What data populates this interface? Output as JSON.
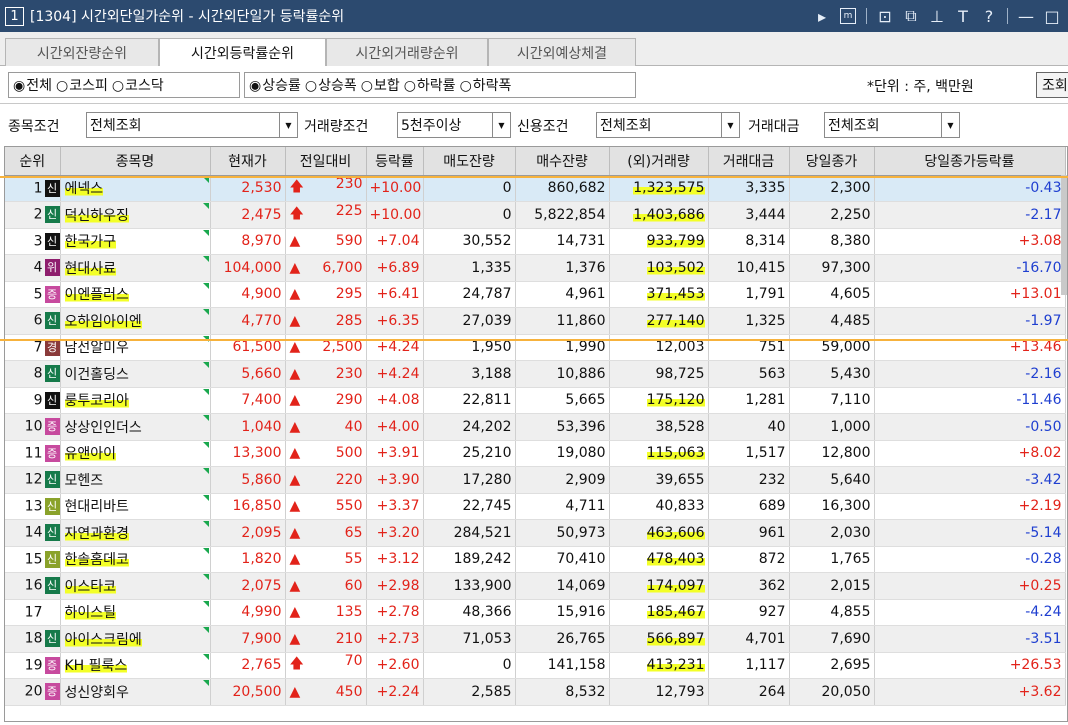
{
  "window": {
    "number": "1",
    "title": "[1304] 시간외단일가순위 - 시간외단일가 등락률순위"
  },
  "tabs": [
    {
      "label": "시간외잔량순위"
    },
    {
      "label": "시간외등락률순위"
    },
    {
      "label": "시간외거래량순위"
    },
    {
      "label": "시간외예상체결"
    }
  ],
  "market_options": [
    "전체",
    "코스피",
    "코스닥"
  ],
  "sort_options": [
    "상승률",
    "상승폭",
    "보합",
    "하락률",
    "하락폭"
  ],
  "unit_text": "*단위 : 주, 백만원",
  "lookup_label": "조회",
  "conditions": {
    "stock_label": "종목조건",
    "stock_value": "전체조회",
    "volume_label": "거래량조건",
    "volume_value": "5천주이상",
    "credit_label": "신용조건",
    "credit_value": "전체조회",
    "amount_label": "거래대금",
    "amount_value": "전체조회"
  },
  "columns": [
    "순위",
    "종목명",
    "현재가",
    "전일대비",
    "등락률",
    "매도잔량",
    "매수잔량",
    "(외)거래량",
    "거래대금",
    "당일종가",
    "당일종가등락률"
  ],
  "rows": [
    {
      "rank": "1",
      "badge": "신",
      "badge_color": "black",
      "name": "에넥스",
      "price": "2,530",
      "change": "230",
      "arrow": "upper",
      "rate": "+10.00",
      "sell": "0",
      "buy": "860,682",
      "volume": "1,323,575",
      "amount": "3,335",
      "close": "2,300",
      "close_rate": "-0.43"
    },
    {
      "rank": "2",
      "badge": "신",
      "badge_color": "green",
      "name": "덕신하우징",
      "price": "2,475",
      "change": "225",
      "arrow": "upper",
      "rate": "+10.00",
      "sell": "0",
      "buy": "5,822,854",
      "volume": "1,403,686",
      "amount": "3,444",
      "close": "2,250",
      "close_rate": "-2.17"
    },
    {
      "rank": "3",
      "badge": "신",
      "badge_color": "black",
      "name": "한국가구",
      "price": "8,970",
      "change": "590",
      "arrow": "up",
      "rate": "+7.04",
      "sell": "30,552",
      "buy": "14,731",
      "volume": "933,799",
      "amount": "8,314",
      "close": "8,380",
      "close_rate": "+3.08"
    },
    {
      "rank": "4",
      "badge": "위",
      "badge_color": "purple",
      "name": "현대사료",
      "price": "104,000",
      "change": "6,700",
      "arrow": "up",
      "rate": "+6.89",
      "sell": "1,335",
      "buy": "1,376",
      "volume": "103,502",
      "amount": "10,415",
      "close": "97,300",
      "close_rate": "-16.70"
    },
    {
      "rank": "5",
      "badge": "증",
      "badge_color": "pink",
      "name": "이엔플러스",
      "price": "4,900",
      "change": "295",
      "arrow": "up",
      "rate": "+6.41",
      "sell": "24,787",
      "buy": "4,961",
      "volume": "371,453",
      "amount": "1,791",
      "close": "4,605",
      "close_rate": "+13.01"
    },
    {
      "rank": "6",
      "badge": "신",
      "badge_color": "green",
      "name": "오하임아이엔",
      "price": "4,770",
      "change": "285",
      "arrow": "up",
      "rate": "+6.35",
      "sell": "27,039",
      "buy": "11,860",
      "volume": "277,140",
      "amount": "1,325",
      "close": "4,485",
      "close_rate": "-1.97"
    },
    {
      "rank": "7",
      "badge": "경",
      "badge_color": "maroon",
      "name": "남선알미우",
      "price": "61,500",
      "change": "2,500",
      "arrow": "up",
      "rate": "+4.24",
      "sell": "1,950",
      "buy": "1,990",
      "volume": "12,003",
      "amount": "751",
      "close": "59,000",
      "close_rate": "+13.46"
    },
    {
      "rank": "8",
      "badge": "신",
      "badge_color": "green",
      "name": "이건홀딩스",
      "price": "5,660",
      "change": "230",
      "arrow": "up",
      "rate": "+4.24",
      "sell": "3,188",
      "buy": "10,886",
      "volume": "98,725",
      "amount": "563",
      "close": "5,430",
      "close_rate": "-2.16"
    },
    {
      "rank": "9",
      "badge": "신",
      "badge_color": "black",
      "name": "룽투코리아",
      "price": "7,400",
      "change": "290",
      "arrow": "up",
      "rate": "+4.08",
      "sell": "22,811",
      "buy": "5,665",
      "volume": "175,120",
      "amount": "1,281",
      "close": "7,110",
      "close_rate": "-11.46"
    },
    {
      "rank": "10",
      "badge": "증",
      "badge_color": "pink",
      "name": "상상인인더스",
      "price": "1,040",
      "change": "40",
      "arrow": "up",
      "rate": "+4.00",
      "sell": "24,202",
      "buy": "53,396",
      "volume": "38,528",
      "amount": "40",
      "close": "1,000",
      "close_rate": "-0.50"
    },
    {
      "rank": "11",
      "badge": "증",
      "badge_color": "pink",
      "name": "유앤아이",
      "price": "13,300",
      "change": "500",
      "arrow": "up",
      "rate": "+3.91",
      "sell": "25,210",
      "buy": "19,080",
      "volume": "115,063",
      "amount": "1,517",
      "close": "12,800",
      "close_rate": "+8.02"
    },
    {
      "rank": "12",
      "badge": "신",
      "badge_color": "green",
      "name": "모헨즈",
      "price": "5,860",
      "change": "220",
      "arrow": "up",
      "rate": "+3.90",
      "sell": "17,280",
      "buy": "2,909",
      "volume": "39,655",
      "amount": "232",
      "close": "5,640",
      "close_rate": "-3.42"
    },
    {
      "rank": "13",
      "badge": "신",
      "badge_color": "olive",
      "name": "현대리바트",
      "price": "16,850",
      "change": "550",
      "arrow": "up",
      "rate": "+3.37",
      "sell": "22,745",
      "buy": "4,711",
      "volume": "40,833",
      "amount": "689",
      "close": "16,300",
      "close_rate": "+2.19"
    },
    {
      "rank": "14",
      "badge": "신",
      "badge_color": "green",
      "name": "자연과환경",
      "price": "2,095",
      "change": "65",
      "arrow": "up",
      "rate": "+3.20",
      "sell": "284,521",
      "buy": "50,973",
      "volume": "463,606",
      "amount": "961",
      "close": "2,030",
      "close_rate": "-5.14"
    },
    {
      "rank": "15",
      "badge": "신",
      "badge_color": "olive",
      "name": "한솔홈데코",
      "price": "1,820",
      "change": "55",
      "arrow": "up",
      "rate": "+3.12",
      "sell": "189,242",
      "buy": "70,410",
      "volume": "478,403",
      "amount": "872",
      "close": "1,765",
      "close_rate": "-0.28"
    },
    {
      "rank": "16",
      "badge": "신",
      "badge_color": "green",
      "name": "이스타코",
      "price": "2,075",
      "change": "60",
      "arrow": "up",
      "rate": "+2.98",
      "sell": "133,900",
      "buy": "14,069",
      "volume": "174,097",
      "amount": "362",
      "close": "2,015",
      "close_rate": "+0.25"
    },
    {
      "rank": "17",
      "badge": "",
      "badge_color": "",
      "name": "하이스틸",
      "price": "4,990",
      "change": "135",
      "arrow": "up",
      "rate": "+2.78",
      "sell": "48,366",
      "buy": "15,916",
      "volume": "185,467",
      "amount": "927",
      "close": "4,855",
      "close_rate": "-4.24"
    },
    {
      "rank": "18",
      "badge": "신",
      "badge_color": "green",
      "name": "아이스크림에",
      "price": "7,900",
      "change": "210",
      "arrow": "up",
      "rate": "+2.73",
      "sell": "71,053",
      "buy": "26,765",
      "volume": "566,897",
      "amount": "4,701",
      "close": "7,690",
      "close_rate": "-3.51"
    },
    {
      "rank": "19",
      "badge": "증",
      "badge_color": "pink",
      "name": "KH 필룩스",
      "price": "2,765",
      "change": "70",
      "arrow": "upper",
      "rate": "+2.60",
      "sell": "0",
      "buy": "141,158",
      "volume": "413,231",
      "amount": "1,117",
      "close": "2,695",
      "close_rate": "+26.53"
    },
    {
      "rank": "20",
      "badge": "증",
      "badge_color": "pink",
      "name": "성신양회우",
      "price": "20,500",
      "change": "450",
      "arrow": "up",
      "rate": "+2.24",
      "sell": "2,585",
      "buy": "8,532",
      "volume": "12,793",
      "amount": "264",
      "close": "20,050",
      "close_rate": "+3.62"
    }
  ],
  "highlighted_names": [
    "에넥스",
    "덕신하우징",
    "한국가구",
    "현대사료",
    "이엔플러스",
    "오하임아이엔",
    "룽투코리아",
    "유앤아이",
    "자연과환경",
    "한솔홈데코",
    "이스타코",
    "하이스틸",
    "아이스크림에",
    "KH 필룩스"
  ],
  "highlighted_volumes": [
    "1,323,575",
    "1,403,686",
    "933,799",
    "103,502",
    "371,453",
    "277,140",
    "175,120",
    "115,063",
    "463,606",
    "478,403",
    "174,097",
    "185,467",
    "566,897",
    "413,231"
  ],
  "colors": {
    "titlebar": "#2c4a6f",
    "up": "#e2231a",
    "down": "#1f3fd0",
    "highlight": "#f3ff27",
    "annotation_line": "#f7b23c",
    "new_flag": "#1aa84e",
    "selected_row": "#d9eaf6"
  },
  "icons": {
    "upper_limit": "bold-up-arrow",
    "rise": "up-triangle"
  }
}
